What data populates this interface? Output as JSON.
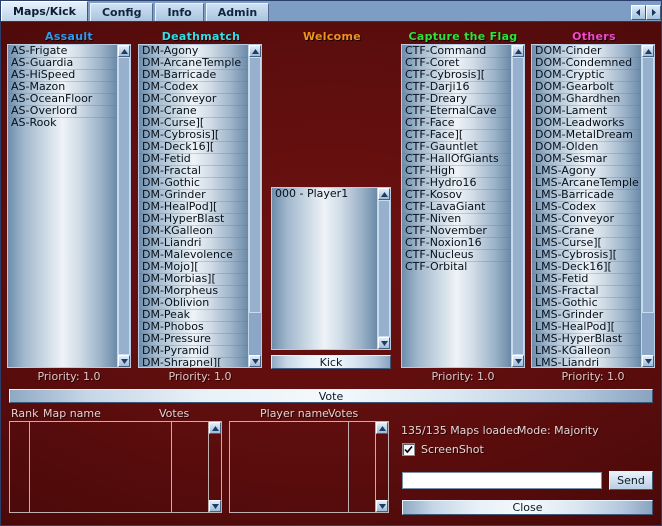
{
  "window": {
    "title": "Maps/Kick",
    "tabs": [
      {
        "label": "Maps/Kick",
        "active": true
      },
      {
        "label": "Config",
        "active": false
      },
      {
        "label": "Info",
        "active": false
      },
      {
        "label": "Admin",
        "active": false
      }
    ],
    "nav_prev_icon": "chevron-left-icon",
    "nav_next_icon": "chevron-right-icon"
  },
  "columns": [
    {
      "id": "assault",
      "title": "Assault",
      "title_color": "#2e9bf0",
      "priority": "Priority: 1.0",
      "maps": [
        "AS-Frigate",
        "AS-Guardia",
        "AS-HiSpeed",
        "AS-Mazon",
        "AS-OceanFloor",
        "AS-Overlord",
        "AS-Rook"
      ]
    },
    {
      "id": "deathmatch",
      "title": "Deathmatch",
      "title_color": "#2fe0e6",
      "priority": "Priority: 1.0",
      "maps": [
        "DM-Agony",
        "DM-ArcaneTemple",
        "DM-Barricade",
        "DM-Codex",
        "DM-Conveyor",
        "DM-Crane",
        "DM-Curse][",
        "DM-Cybrosis][",
        "DM-Deck16][",
        "DM-Fetid",
        "DM-Fractal",
        "DM-Gothic",
        "DM-Grinder",
        "DM-HealPod][",
        "DM-HyperBlast",
        "DM-KGalleon",
        "DM-Liandri",
        "DM-Malevolence",
        "DM-Mojo][",
        "DM-Morbias][",
        "DM-Morpheus",
        "DM-Oblivion",
        "DM-Peak",
        "DM-Phobos",
        "DM-Pressure",
        "DM-Pyramid",
        "DM-Shrapnel]["
      ]
    },
    {
      "id": "capturetheflag",
      "title": "Capture the Flag",
      "title_color": "#2ae53a",
      "priority": "Priority: 1.0",
      "maps": [
        "CTF-Command",
        "CTF-Coret",
        "CTF-Cybrosis][",
        "CTF-Darji16",
        "CTF-Dreary",
        "CTF-EternalCave",
        "CTF-Face",
        "CTF-Face][",
        "CTF-Gauntlet",
        "CTF-HallOfGiants",
        "CTF-High",
        "CTF-Hydro16",
        "CTF-Kosov",
        "CTF-LavaGiant",
        "CTF-Niven",
        "CTF-November",
        "CTF-Noxion16",
        "CTF-Nucleus",
        "CTF-Orbital"
      ]
    },
    {
      "id": "others",
      "title": "Others",
      "title_color": "#f04ad0",
      "priority": "Priority: 1.0",
      "maps": [
        "DOM-Cinder",
        "DOM-Condemned",
        "DOM-Cryptic",
        "DOM-Gearbolt",
        "DOM-Ghardhen",
        "DOM-Lament",
        "DOM-Leadworks",
        "DOM-MetalDream",
        "DOM-Olden",
        "DOM-Sesmar",
        "LMS-Agony",
        "LMS-ArcaneTemple",
        "LMS-Barricade",
        "LMS-Codex",
        "LMS-Conveyor",
        "LMS-Crane",
        "LMS-Curse][",
        "LMS-Cybrosis][",
        "LMS-Deck16][",
        "LMS-Fetid",
        "LMS-Fractal",
        "LMS-Gothic",
        "LMS-Grinder",
        "LMS-HealPod][",
        "LMS-HyperBlast",
        "LMS-KGalleon",
        "LMS-Liandri"
      ]
    }
  ],
  "welcome": {
    "title": "Welcome",
    "title_color": "#f0921e",
    "players": [
      "000 - Player1"
    ],
    "kick_label": "Kick"
  },
  "vote": {
    "label": "Vote"
  },
  "map_votes_table": {
    "headers": [
      "Rank",
      "Map name",
      "Votes"
    ],
    "rows": []
  },
  "player_votes_table": {
    "headers": [
      "Player name",
      "Votes"
    ],
    "rows": []
  },
  "status": {
    "maps_loaded": "135/135 Maps loaded",
    "mode": "Mode: Majority",
    "screenshot_label": "ScreenShot",
    "screenshot_checked": true,
    "chat_value": "",
    "chat_placeholder": "",
    "send_label": "Send",
    "close_label": "Close"
  }
}
